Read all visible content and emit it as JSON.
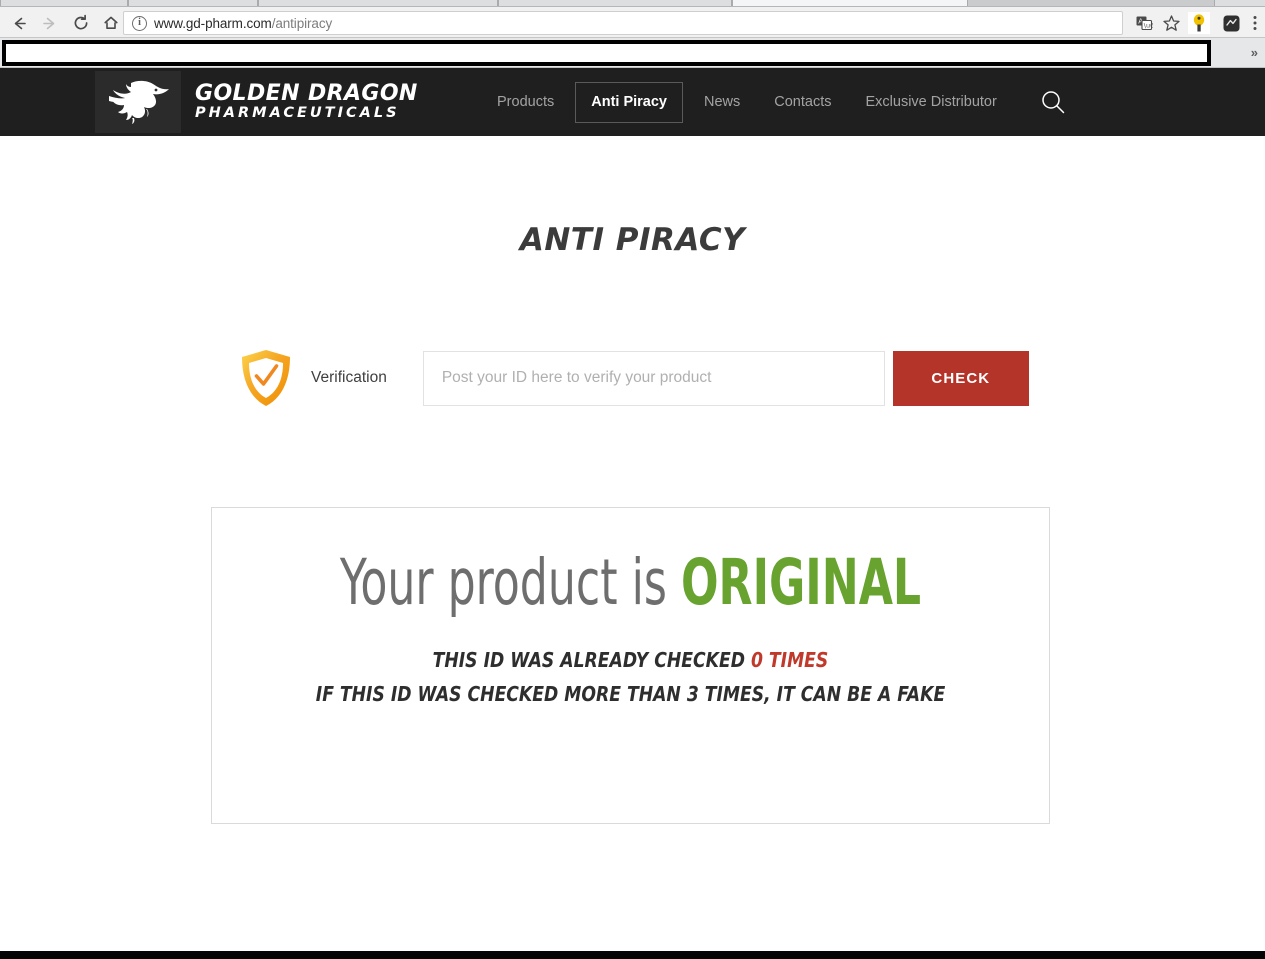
{
  "browser": {
    "back_icon": "back-arrow-icon",
    "forward_icon": "forward-arrow-icon",
    "reload_icon": "reload-icon",
    "home_icon": "home-icon",
    "security_icon": "info-circle-icon",
    "url_host": "www.gd-pharm.com",
    "url_path": "/antipiracy",
    "translate_icon": "translate-icon",
    "bookmark_icon": "star-icon",
    "extension_1_icon": "extension-icon",
    "extension_2_icon": "extension-icon",
    "menu_icon": "three-dots-menu-icon",
    "bookmarks_overflow": "»"
  },
  "site": {
    "logo": {
      "icon": "dragon-logo-icon",
      "title": "GOLDEN DRAGON",
      "subtitle": "PHARMACEUTICALS"
    },
    "nav": {
      "items": [
        {
          "label": "Products",
          "active": false
        },
        {
          "label": "Anti Piracy",
          "active": true
        },
        {
          "label": "News",
          "active": false
        },
        {
          "label": "Contacts",
          "active": false
        },
        {
          "label": "Exclusive Distributor",
          "active": false
        }
      ],
      "search_icon": "search-icon"
    },
    "page_title": "ANTI PIRACY",
    "verification": {
      "shield_icon": "shield-check-icon",
      "label": "Verification",
      "input_value": "",
      "input_placeholder": "Post your ID here to verify your product",
      "check_label": "CHECK"
    },
    "result": {
      "heading_prefix": "Your product is",
      "verdict": "ORIGINAL",
      "line1_prefix": "THIS ID WAS ALREADY CHECKED",
      "line1_count": "0 TIMES",
      "line2": "IF THIS ID WAS CHECKED MORE THAN 3 TIMES, IT CAN BE A FAKE"
    }
  },
  "colors": {
    "header_bg": "#1f1f1f",
    "accent_red": "#b5342a",
    "verdict_green": "#67a32e",
    "count_red": "#c0392b",
    "shield_orange": "#f5a623"
  }
}
